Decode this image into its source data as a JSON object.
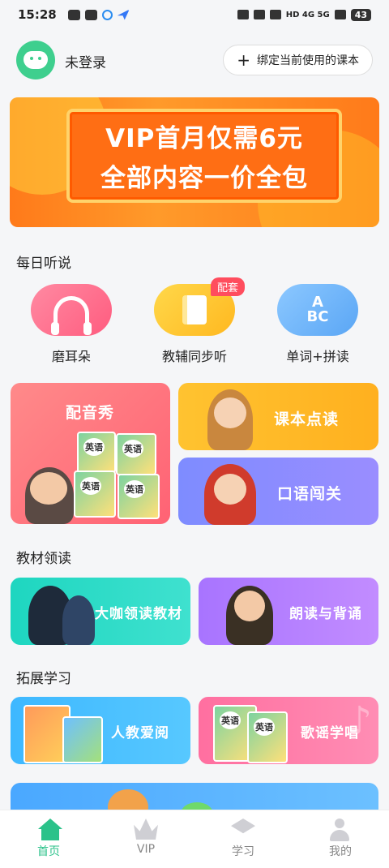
{
  "status_bar": {
    "time": "15:28",
    "right_text": "HD 4G 5G",
    "battery": "43"
  },
  "header": {
    "login_status": "未登录",
    "bind_button": "绑定当前使用的课本"
  },
  "banner": {
    "line1": "VIP首月仅需6元",
    "line2": "全部内容一价全包"
  },
  "sections": {
    "daily": "每日听说",
    "textbook": "教材领读",
    "extend": "拓展学习"
  },
  "quick_items": [
    {
      "label": "磨耳朵",
      "icon": "headphone-icon"
    },
    {
      "label": "教辅同步听",
      "icon": "book-icon",
      "tag": "配套"
    },
    {
      "label": "单词+拼读",
      "icon": "abc-icon",
      "icon_text": "A\nBC"
    }
  ],
  "cards": {
    "dub": "配音秀",
    "read": "课本点读",
    "oral": "口语闯关",
    "lead": "大咖领读教材",
    "recite": "朗读与背诵",
    "love": "人教爱阅",
    "song": "歌谣学唱"
  },
  "book_label": "英语",
  "tabs": [
    {
      "label": "首页",
      "icon": "home-icon",
      "active": true
    },
    {
      "label": "VIP",
      "icon": "crown-icon",
      "active": false
    },
    {
      "label": "学习",
      "icon": "graduation-cap-icon",
      "active": false
    },
    {
      "label": "我的",
      "icon": "profile-icon",
      "active": false
    }
  ],
  "colors": {
    "accent": "#2bc28a",
    "banner": "#ff7a1a",
    "tag": "#ff4d5e"
  }
}
